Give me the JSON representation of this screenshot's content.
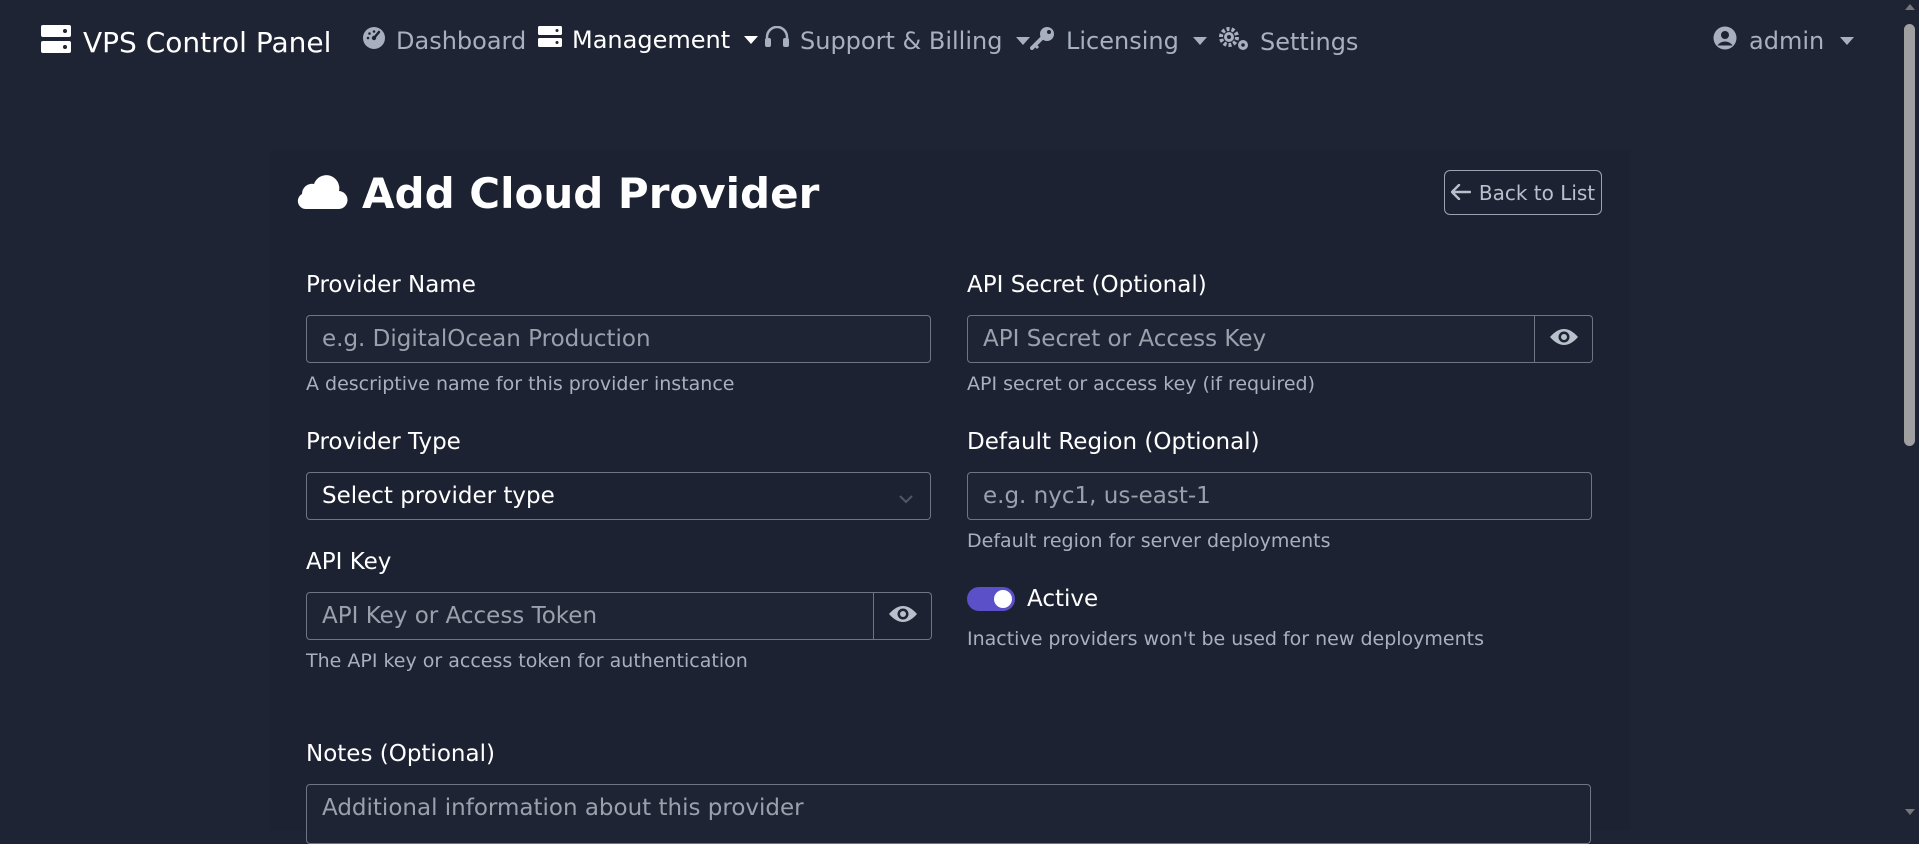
{
  "brand": {
    "title": "VPS Control Panel",
    "icon": "server-icon"
  },
  "nav": {
    "dashboard": "Dashboard",
    "management": "Management",
    "support_billing": "Support & Billing",
    "licensing": "Licensing",
    "settings": "Settings",
    "user": "admin"
  },
  "page": {
    "title": "Add Cloud Provider",
    "title_icon": "cloud-icon",
    "back_button": "Back to List"
  },
  "form": {
    "provider_name": {
      "label": "Provider Name",
      "placeholder": "e.g. DigitalOcean Production",
      "help": "A descriptive name for this provider instance"
    },
    "provider_type": {
      "label": "Provider Type",
      "selected": "Select provider type"
    },
    "api_key": {
      "label": "API Key",
      "placeholder": "API Key or Access Token",
      "help": "The API key or access token for authentication"
    },
    "api_secret": {
      "label": "API Secret (Optional)",
      "placeholder": "API Secret or Access Key",
      "help": "API secret or access key (if required)"
    },
    "default_region": {
      "label": "Default Region (Optional)",
      "placeholder": "e.g. nyc1, us-east-1",
      "help": "Default region for server deployments"
    },
    "active": {
      "label": "Active",
      "checked": true,
      "help": "Inactive providers won't be used for new deployments"
    },
    "notes": {
      "label": "Notes (Optional)",
      "placeholder": "Additional information about this provider"
    }
  },
  "colors": {
    "background": "#1e2433",
    "toggle_accent": "#5b50c8",
    "muted_text": "#a8b0bf"
  }
}
